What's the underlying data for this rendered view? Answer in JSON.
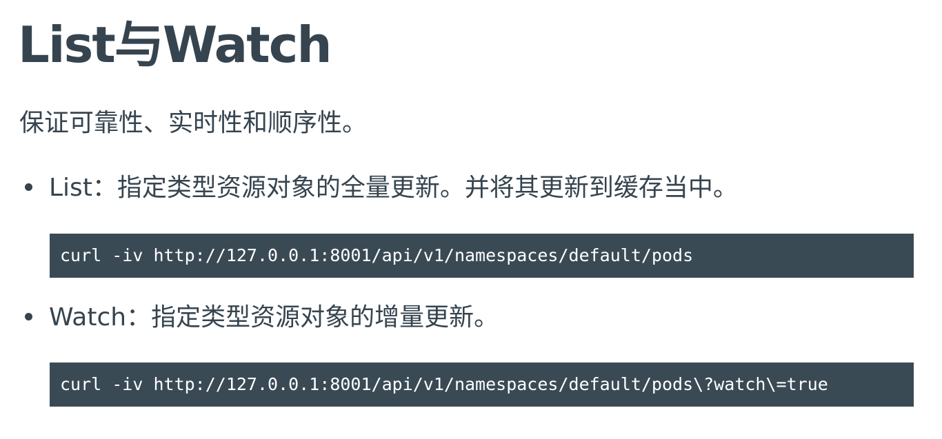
{
  "title": "List与Watch",
  "intro": "保证可靠性、实时性和顺序性。",
  "items": [
    {
      "label": "List：指定类型资源对象的全量更新。并将其更新到缓存当中。",
      "code": "curl -iv http://127.0.0.1:8001/api/v1/namespaces/default/pods"
    },
    {
      "label": "Watch：指定类型资源对象的增量更新。",
      "code": "curl -iv http://127.0.0.1:8001/api/v1/namespaces/default/pods\\?watch\\=true"
    }
  ],
  "colors": {
    "text": "#36444f",
    "code_background": "#3a4a55",
    "code_text": "#ffffff",
    "page_background": "#ffffff"
  }
}
